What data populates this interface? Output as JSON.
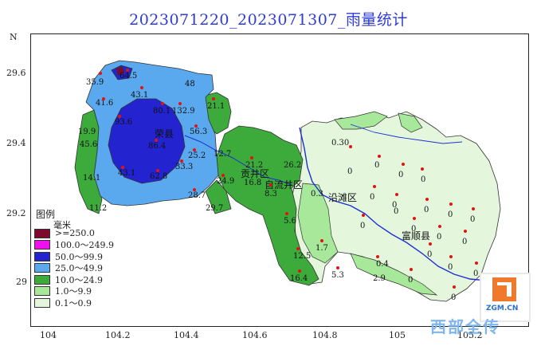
{
  "title": "2023071220_2023071307_雨量统计",
  "axes": {
    "north_label": "N",
    "y_ticks": [
      "29.6",
      "29.4",
      "29.2",
      "29"
    ],
    "x_ticks": [
      "104",
      "104.2",
      "104.4",
      "104.6",
      "104.8",
      "105",
      "105.2"
    ]
  },
  "legend": {
    "title": "图例",
    "unit": "毫米",
    "items": [
      {
        "label": ">=250.0",
        "color": "#7b0a2e"
      },
      {
        "label": "100.0～249.9",
        "color": "#ee11ee"
      },
      {
        "label": "50.0～99.9",
        "color": "#2323d0"
      },
      {
        "label": "25.0～49.9",
        "color": "#5aa9ee"
      },
      {
        "label": "10.0～24.9",
        "color": "#3cab3c"
      },
      {
        "label": "1.0～9.9",
        "color": "#a7e89a"
      },
      {
        "label": "0.1～0.9",
        "color": "#e4f7dc"
      }
    ]
  },
  "places": [
    "荣县",
    "贡井区",
    "自流井区",
    "沿滩区",
    "富顺县"
  ],
  "station_values": [
    "35.9",
    "64.5",
    "43.1",
    "41.6",
    "80.1",
    "132.9",
    "21.1",
    "19.9",
    "93.6",
    "48",
    "56.3",
    "45.6",
    "86.4",
    "25.2",
    "12.7",
    "14.1",
    "43.1",
    "62.8",
    "33.3",
    "21.2",
    "26.2",
    "24.9",
    "16.8",
    "28.7",
    "29.7",
    "11.2",
    "8.3",
    "0.3",
    "5.6",
    "12.5",
    "1.7",
    "16.4",
    "5.3",
    "2.9",
    "0.4",
    "0",
    "0.30"
  ],
  "watermark": {
    "site": "ZGM.CN",
    "text": "西部全传"
  }
}
